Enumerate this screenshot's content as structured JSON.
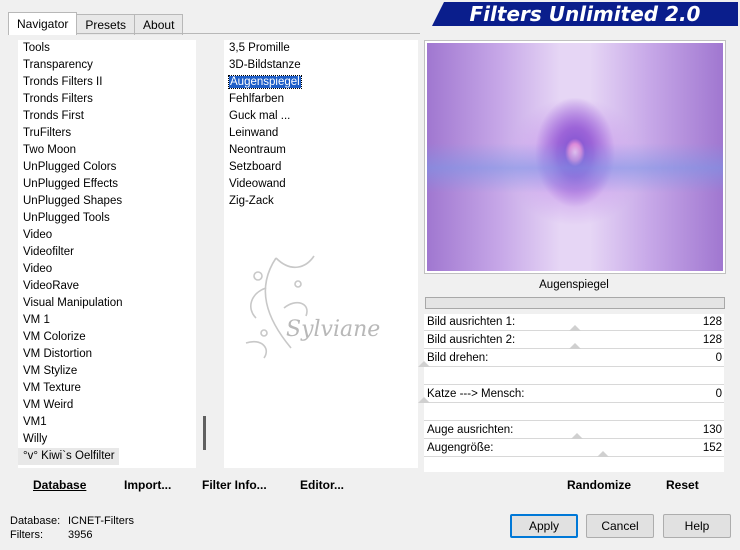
{
  "tabs": [
    {
      "label": "Navigator",
      "active": true
    },
    {
      "label": "Presets",
      "active": false
    },
    {
      "label": "About",
      "active": false
    }
  ],
  "banner": {
    "title": "Filters Unlimited 2.0"
  },
  "categories": [
    "Tools",
    "Transparency",
    "Tronds Filters II",
    "Tronds Filters",
    "Tronds First",
    "TruFilters",
    "Two Moon",
    "UnPlugged Colors",
    "UnPlugged Effects",
    "UnPlugged Shapes",
    "UnPlugged Tools",
    "Video",
    "Videofilter",
    "Video",
    "VideoRave",
    "Visual Manipulation",
    "VM 1",
    "VM Colorize",
    "VM Distortion",
    "VM Stylize",
    "VM Texture",
    "VM Weird",
    "VM1",
    "Willy",
    "°v° Kiwi`s Oelfilter"
  ],
  "filters": [
    {
      "label": "3,5 Promille",
      "selected": false
    },
    {
      "label": "3D-Bildstanze",
      "selected": false
    },
    {
      "label": "Augenspiegel",
      "selected": true
    },
    {
      "label": "Fehlfarben",
      "selected": false
    },
    {
      "label": "Guck mal ...",
      "selected": false
    },
    {
      "label": "Leinwand",
      "selected": false
    },
    {
      "label": "Neontraum",
      "selected": false
    },
    {
      "label": "Setzboard",
      "selected": false
    },
    {
      "label": "Videowand",
      "selected": false
    },
    {
      "label": "Zig-Zack",
      "selected": false
    }
  ],
  "watermark": {
    "text": "Sylviane"
  },
  "preview": {
    "filter_name": "Augenspiegel"
  },
  "params": [
    {
      "label": "Bild ausrichten 1:",
      "value": "128",
      "fraction": 0.502
    },
    {
      "label": "Bild ausrichten 2:",
      "value": "128",
      "fraction": 0.502
    },
    {
      "label": "Bild drehen:",
      "value": "0",
      "fraction": 0.0
    },
    {
      "label": "",
      "value": "",
      "fraction": null
    },
    {
      "label": "Katze ---> Mensch:",
      "value": "0",
      "fraction": 0.0
    },
    {
      "label": "",
      "value": "",
      "fraction": null
    },
    {
      "label": "Auge ausrichten:",
      "value": "130",
      "fraction": 0.51
    },
    {
      "label": "Augengröße:",
      "value": "152",
      "fraction": 0.596
    }
  ],
  "buttons": {
    "database": "Database",
    "import": "Import...",
    "filter_info": "Filter Info...",
    "editor": "Editor...",
    "randomize": "Randomize",
    "reset": "Reset",
    "apply": "Apply",
    "cancel": "Cancel",
    "help": "Help"
  },
  "info": {
    "database_label": "Database:",
    "database_value": "ICNET-Filters",
    "filters_label": "Filters:",
    "filters_value": "3956"
  },
  "colors": {
    "banner": "#0a1e8c",
    "selection": "#1f5fc8",
    "default_button_border": "#0078d7"
  }
}
